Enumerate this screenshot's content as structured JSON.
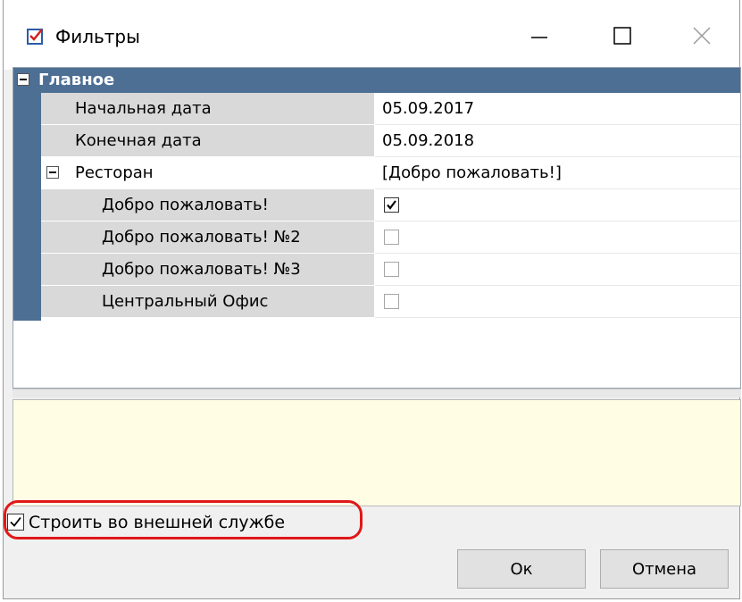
{
  "window": {
    "title": "Фильтры",
    "icon": "checklist-icon",
    "controls": [
      "minimize-icon",
      "maximize-icon",
      "close-icon"
    ]
  },
  "grid": {
    "group": {
      "title": "Главное",
      "expanded": true
    },
    "rows": {
      "start_date": {
        "label": "Начальная дата",
        "value": "05.09.2017"
      },
      "end_date": {
        "label": "Конечная дата",
        "value": "05.09.2018"
      },
      "restaurant": {
        "label": "Ресторан",
        "value": "[Добро пожаловать!]",
        "expanded": true
      },
      "options": [
        {
          "label": "Добро пожаловать!",
          "checked": true
        },
        {
          "label": "Добро пожаловать! №2",
          "checked": false
        },
        {
          "label": "Добро пожаловать! №3",
          "checked": false
        },
        {
          "label": "Центральный Офис",
          "checked": false
        }
      ]
    }
  },
  "external_service": {
    "label": "Строить во внешней службе",
    "checked": true,
    "highlight_color": "#e01818"
  },
  "buttons": {
    "ok": "Ок",
    "cancel": "Отмена"
  },
  "colors": {
    "group_header": "#4e6f94",
    "description_panel": "#fffde4"
  }
}
